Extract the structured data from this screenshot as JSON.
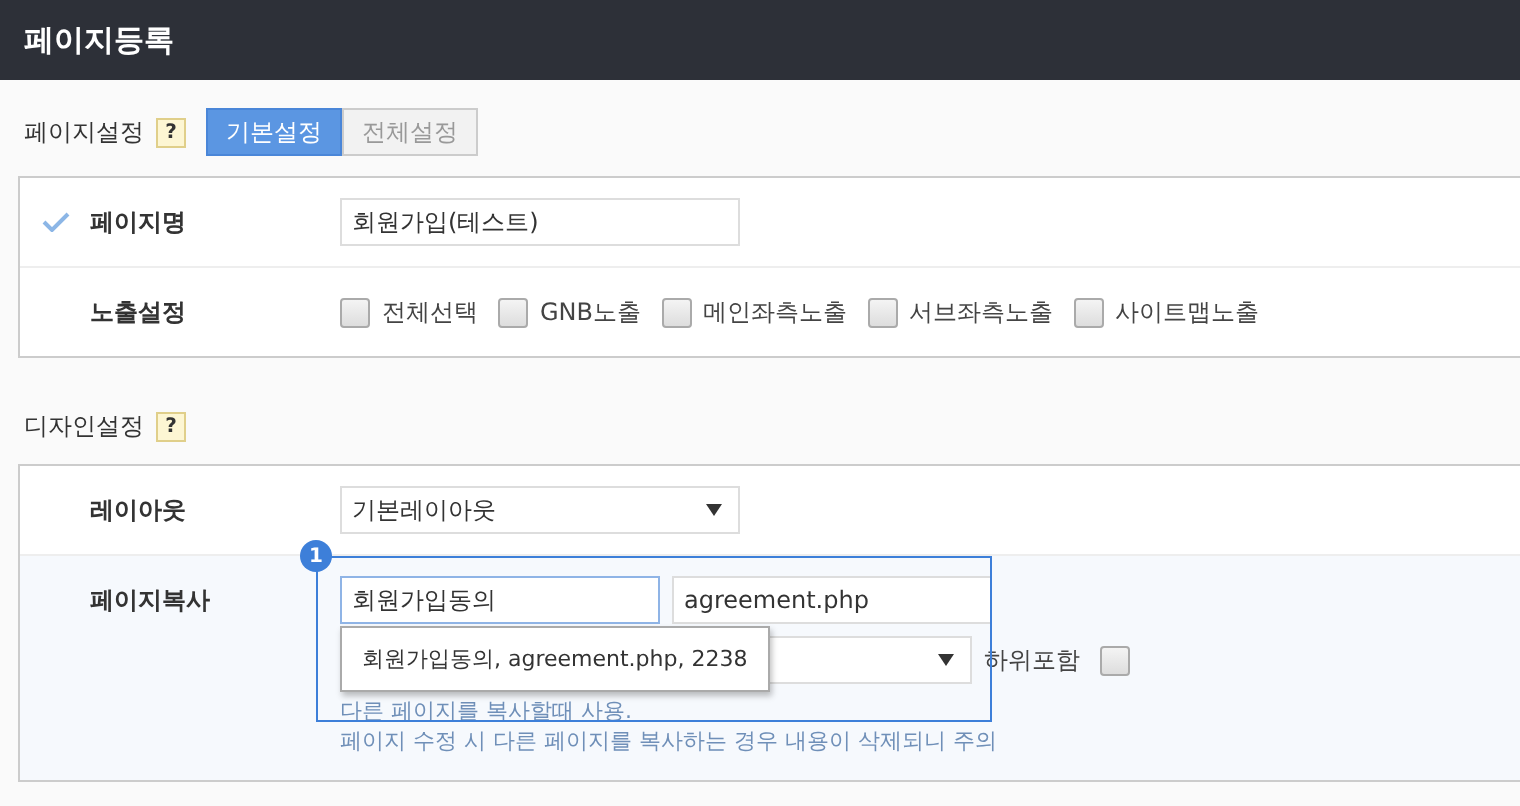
{
  "header": {
    "title": "페이지등록"
  },
  "page_settings": {
    "label": "페이지설정",
    "help": "?",
    "tabs": [
      {
        "label": "기본설정",
        "selected": true
      },
      {
        "label": "전체설정",
        "selected": false
      }
    ],
    "name_row": {
      "label": "페이지명",
      "value": "회원가입(테스트)",
      "checked": true
    },
    "exposure_row": {
      "label": "노출설정",
      "options": [
        {
          "label": "전체선택",
          "checked": false
        },
        {
          "label": "GNB노출",
          "checked": false
        },
        {
          "label": "메인좌측노출",
          "checked": false
        },
        {
          "label": "서브좌측노출",
          "checked": false
        },
        {
          "label": "사이트맵노출",
          "checked": false
        }
      ]
    }
  },
  "design_settings": {
    "label": "디자인설정",
    "help": "?",
    "layout_row": {
      "label": "레이아웃",
      "value": "기본레이아웃"
    },
    "copy_row": {
      "label": "페이지복사",
      "search_value": "회원가입동의",
      "file_value": "agreement.php",
      "include_children": {
        "label": "하위포함",
        "checked": false
      },
      "suggestions": [
        "회원가입동의, agreement.php, 2238"
      ],
      "hints": [
        "다른 페이지를 복사할때 사용.",
        "페이지 수정 시 다른 페이지를 복사하는 경우 내용이 삭제되니 주의"
      ],
      "annotation": {
        "badge": "1"
      }
    }
  }
}
